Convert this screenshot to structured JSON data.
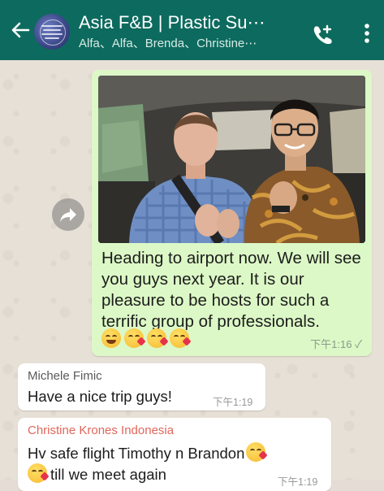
{
  "header": {
    "title": "Asia F&B | Plastic Su⋯",
    "members": "Alfa、Alfa、Brenda、Christine⋯"
  },
  "messages": {
    "outgoing": {
      "text": "Heading to airport now. We will see  you guys next year. It is our pleasure to be hosts for such a terrific group of professionals.",
      "emojis": [
        "grinning-face",
        "face-blowing-kiss",
        "face-blowing-kiss",
        "face-blowing-kiss"
      ],
      "time": "下午1:16",
      "status": "✓"
    },
    "incoming": [
      {
        "sender": "Michele Fimic",
        "sender_color": "#5a5a5a",
        "text": "Have a nice trip guys!",
        "time": "下午1:19"
      },
      {
        "sender": "Christine Krones Indonesia",
        "sender_color": "#e0665b",
        "line1": "Hv safe flight Timothy n Brandon",
        "line2": "till we meet again",
        "time": "下午1:19"
      }
    ]
  },
  "colors": {
    "header": "#0d6a5e",
    "outgoing_bubble": "#dcf8c6",
    "incoming_bubble": "#ffffff",
    "wallpaper": "#e5ddd5"
  },
  "icons": [
    "back-arrow-icon",
    "group-avatar",
    "add-call-icon",
    "more-vert-icon",
    "forward-icon"
  ]
}
